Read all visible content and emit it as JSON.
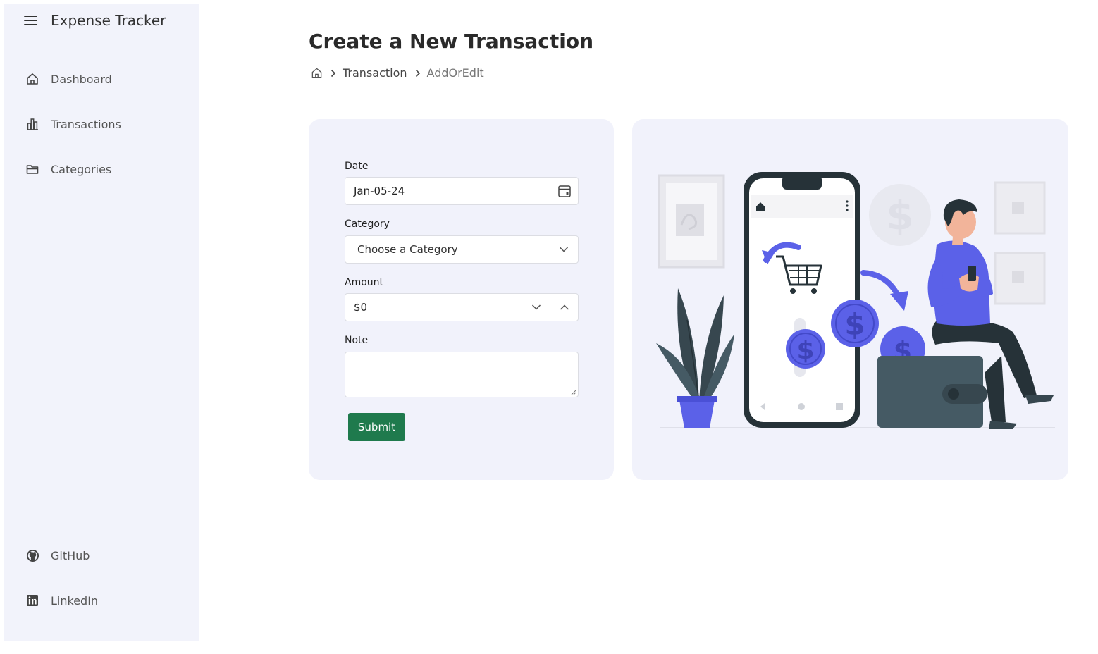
{
  "app": {
    "title": "Expense Tracker"
  },
  "sidebar": {
    "items": [
      {
        "label": "Dashboard",
        "icon": "home-icon"
      },
      {
        "label": "Transactions",
        "icon": "bar-chart-icon"
      },
      {
        "label": "Categories",
        "icon": "folder-icon"
      }
    ],
    "footer": [
      {
        "label": "GitHub",
        "icon": "github-icon"
      },
      {
        "label": "LinkedIn",
        "icon": "linkedin-icon"
      }
    ]
  },
  "page": {
    "title": "Create a New Transaction",
    "breadcrumb": {
      "link": "Transaction",
      "current": "AddOrEdit"
    }
  },
  "form": {
    "date": {
      "label": "Date",
      "value": "Jan-05-24"
    },
    "category": {
      "label": "Category",
      "value": "Choose a Category"
    },
    "amount": {
      "label": "Amount",
      "value": "$0"
    },
    "note": {
      "label": "Note",
      "value": ""
    },
    "submit_label": "Submit"
  },
  "colors": {
    "sidebar_bg": "#f2f3fb",
    "card_bg": "#f1f2fb",
    "submit_bg": "#1f7a4d",
    "illustration_accent": "#5b61e8"
  }
}
